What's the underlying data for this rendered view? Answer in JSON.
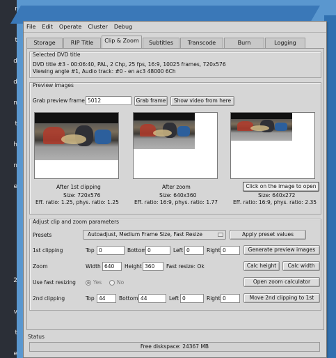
{
  "sidebar_chars": [
    "r",
    "t",
    "d",
    "d",
    "n",
    "t",
    "h",
    "n",
    "e",
    "2",
    "v",
    "t",
    "e"
  ],
  "menu": [
    "File",
    "Edit",
    "Operate",
    "Cluster",
    "Debug"
  ],
  "tabs": [
    "Storage",
    "RIP Title",
    "Clip & Zoom",
    "Subtitles",
    "Transcode",
    "Burn",
    "Logging"
  ],
  "active_tab": "Clip & Zoom",
  "dvd": {
    "frame_title": "Selected DVD title",
    "line1": "DVD title #3 - 00:06:40, PAL, 2 Chp, 25 fps, 16:9, 10025 frames, 720x576",
    "line2": "Viewing angle #1, Audio track: #0 - en ac3 48000 6Ch"
  },
  "preview": {
    "frame_title": "Preview images",
    "grab_label": "Grab preview frame #",
    "grab_value": "5012",
    "grab_button": "Grab frame",
    "show_video_button": "Show video from here",
    "images": [
      {
        "caption": "After 1st clipping",
        "size": "Size: 720x576",
        "ratio": "Eff. ratio: 1.25, phys. ratio: 1.25"
      },
      {
        "caption": "After zoom",
        "size": "Size: 640x360",
        "ratio": "Eff. ratio: 16:9, phys. ratio: 1.77"
      },
      {
        "caption": "Click on the image to open",
        "size": "Size: 640x272",
        "ratio": "Eff. ratio: 16:9, phys. ratio: 2.35"
      }
    ]
  },
  "params": {
    "frame_title": "Adjust clip and zoom parameters",
    "presets_label": "Presets",
    "presets_value": "Autoadjust, Medium Frame Size, Fast Resize",
    "apply_preset_button": "Apply preset values",
    "clip1": {
      "label": "1st clipping",
      "top_label": "Top",
      "top": "0",
      "bottom_label": "Bottom",
      "bottom": "0",
      "left_label": "Left",
      "left": "0",
      "right_label": "Right",
      "right": "0"
    },
    "generate_button": "Generate preview images",
    "zoom": {
      "label": "Zoom",
      "width_label": "Width",
      "width": "640",
      "height_label": "Height",
      "height": "360",
      "fast_resize": "Fast resize: Ok"
    },
    "calc_height_button": "Calc height",
    "calc_width_button": "Calc width",
    "fast_resizing": {
      "label": "Use fast resizing",
      "yes": "Yes",
      "no": "No"
    },
    "zoom_calc_button": "Open zoom calculator",
    "clip2": {
      "label": "2nd clipping",
      "top_label": "Top",
      "top": "44",
      "bottom_label": "Bottom",
      "bottom": "44",
      "left_label": "Left",
      "left": "0",
      "right_label": "Right",
      "right": "0"
    },
    "move_clip_button": "Move 2nd clipping to 1st"
  },
  "status": {
    "frame_title": "Status",
    "text": "Free diskspace: 24367 MB"
  }
}
